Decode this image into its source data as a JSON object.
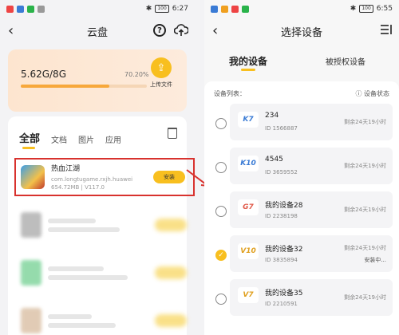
{
  "left": {
    "status": {
      "time": "6:27",
      "battery": "100"
    },
    "title": "云盘",
    "storage": {
      "used": "5.62G/8G",
      "percent_label": "70.20%",
      "percent": 70.2,
      "upload_label": "上传文件"
    },
    "tabs": [
      {
        "label": "全部"
      },
      {
        "label": "文档"
      },
      {
        "label": "图片"
      },
      {
        "label": "应用"
      }
    ],
    "apps": [
      {
        "name": "热血江湖",
        "package": "com.longtugame.rxjh.huawei",
        "meta": "654.72MB | V117.0",
        "button": "安装"
      }
    ]
  },
  "right": {
    "status": {
      "time": "6:55",
      "battery": "100"
    },
    "title": "选择设备",
    "tabs": {
      "mine": "我的设备",
      "authorized": "被授权设备"
    },
    "list_label": "设备列表：",
    "status_label": "设备状态",
    "devices": [
      {
        "name": "234",
        "id": "ID 1566887",
        "logo": "K7",
        "logo_color": "#3a7bd5",
        "remain": "剩余24天19小时",
        "status": "",
        "selected": false
      },
      {
        "name": "4545",
        "id": "ID 3659552",
        "logo": "K10",
        "logo_color": "#3a7bd5",
        "remain": "剩余24天19小时",
        "status": "",
        "selected": false
      },
      {
        "name": "我的设备28",
        "id": "ID 2238198",
        "logo": "G7",
        "logo_color": "#e05a4a",
        "remain": "剩余24天19小时",
        "status": "",
        "selected": false
      },
      {
        "name": "我的设备32",
        "id": "ID 3835894",
        "logo": "V10",
        "logo_color": "#e0a020",
        "remain": "剩余24天19小时",
        "status": "安装中...",
        "selected": true
      },
      {
        "name": "我的设备35",
        "id": "ID 2210591",
        "logo": "V7",
        "logo_color": "#e0a020",
        "remain": "剩余24天19小时",
        "status": "",
        "selected": false
      }
    ]
  },
  "colors": {
    "accent": "#f8bf1f",
    "highlight": "#d8322e",
    "progress": "#f7a83b"
  }
}
